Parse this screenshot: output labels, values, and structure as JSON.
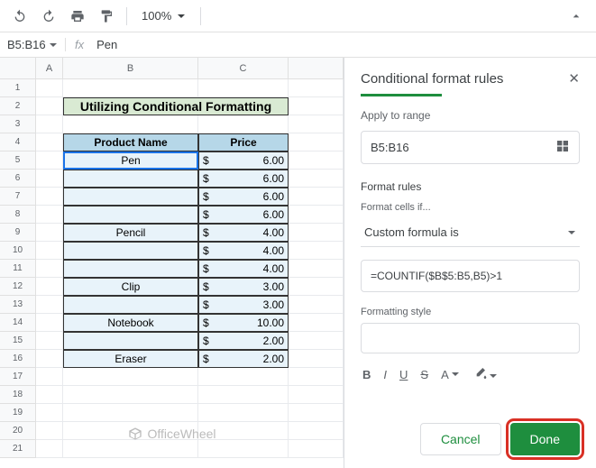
{
  "toolbar": {
    "zoom": "100%"
  },
  "formula_bar": {
    "name_box": "B5:B16",
    "fx": "fx",
    "value": "Pen"
  },
  "columns": [
    "A",
    "B",
    "C"
  ],
  "rows": [
    "1",
    "2",
    "3",
    "4",
    "5",
    "6",
    "7",
    "8",
    "9",
    "10",
    "11",
    "12",
    "13",
    "14",
    "15",
    "16",
    "17",
    "18",
    "19",
    "20",
    "21"
  ],
  "sheet": {
    "title": "Utilizing Conditional Formatting",
    "header_b": "Product Name",
    "header_c": "Price",
    "data": [
      {
        "name": "Pen",
        "price": "6.00"
      },
      {
        "name": "",
        "price": "6.00"
      },
      {
        "name": "",
        "price": "6.00"
      },
      {
        "name": "",
        "price": "6.00"
      },
      {
        "name": "Pencil",
        "price": "4.00"
      },
      {
        "name": "",
        "price": "4.00"
      },
      {
        "name": "",
        "price": "4.00"
      },
      {
        "name": "Clip",
        "price": "3.00"
      },
      {
        "name": "",
        "price": "3.00"
      },
      {
        "name": "Notebook",
        "price": "10.00"
      },
      {
        "name": "",
        "price": "2.00"
      },
      {
        "name": "Eraser",
        "price": "2.00"
      }
    ],
    "currency": "$"
  },
  "sidebar": {
    "title": "Conditional format rules",
    "apply_label": "Apply to range",
    "range": "B5:B16",
    "rules_label": "Format rules",
    "cells_if": "Format cells if...",
    "rule_type": "Custom formula is",
    "formula": "=COUNTIF($B$5:B5,B5)>1",
    "style_label": "Formatting style",
    "cancel": "Cancel",
    "done": "Done"
  },
  "watermark": "OfficeWheel"
}
